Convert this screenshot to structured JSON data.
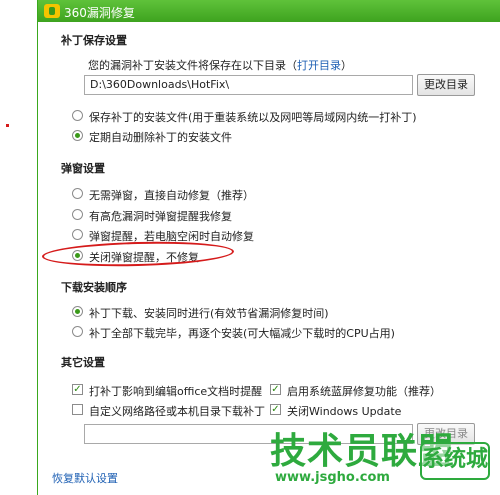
{
  "window": {
    "title": "360漏洞修复"
  },
  "patch_save": {
    "section_title": "补丁保存设置",
    "desc": "您的漏洞补丁安装文件将保存在以下目录（",
    "open_dir_link": "打开目录",
    "desc_close": "）",
    "path_value": "D:\\360Downloads\\HotFix\\",
    "change_dir_button": "更改目录",
    "options": [
      {
        "label": "保存补丁的安装文件(用于重装系统以及网吧等局域网内统一打补丁)",
        "selected": false
      },
      {
        "label": "定期自动删除补丁的安装文件",
        "selected": true
      }
    ]
  },
  "popup": {
    "section_title": "弹窗设置",
    "options": [
      {
        "label": "无需弹窗，直接自动修复（推荐）",
        "selected": false
      },
      {
        "label": "有高危漏洞时弹窗提醒我修复",
        "selected": false
      },
      {
        "label": "弹窗提醒，若电脑空闲时自动修复",
        "selected": false
      },
      {
        "label": "关闭弹窗提醒，不修复",
        "selected": true
      }
    ]
  },
  "download": {
    "section_title": "下载安装顺序",
    "options": [
      {
        "label": "补丁下载、安装同时进行(有效节省漏洞修复时间)",
        "selected": true
      },
      {
        "label": "补丁全部下载完毕，再逐个安装(可大幅减少下载时的CPU占用)",
        "selected": false
      }
    ]
  },
  "other": {
    "section_title": "其它设置",
    "checks": [
      {
        "label": "打补丁影响到编辑office文档时提醒",
        "checked": true
      },
      {
        "label": "启用系统蓝屏修复功能（推荐）",
        "checked": true
      },
      {
        "label": "自定义网络路径或本机目录下载补丁",
        "checked": false
      },
      {
        "label": "关闭Windows Update",
        "checked": true
      }
    ],
    "path_placeholder": "",
    "change_dir_button": "更改目录"
  },
  "footer": {
    "restore_link": "恢复默认设置"
  },
  "watermark": {
    "brand": "技术员联盟",
    "url": "www.jsgho.com",
    "badge": "系统城"
  },
  "colors": {
    "accent_green": "#3ea31f",
    "link_blue": "#1d5fb3",
    "annotation_red": "#d51b1b"
  }
}
